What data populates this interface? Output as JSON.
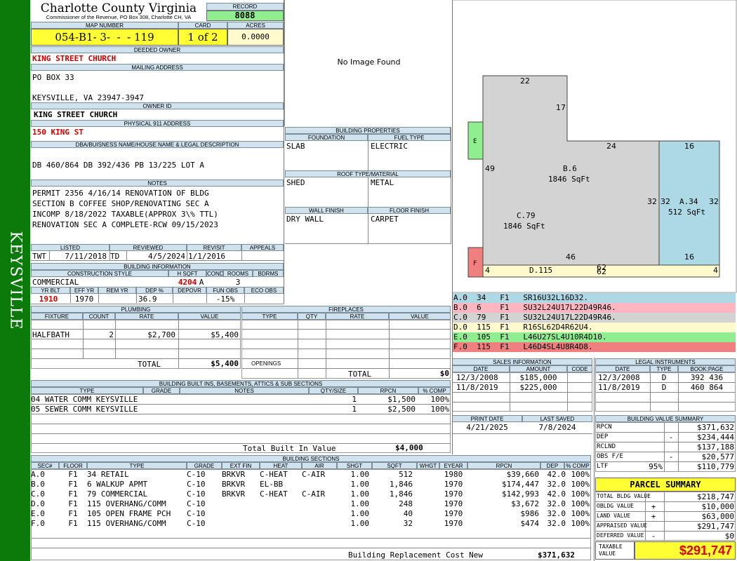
{
  "sidebar": {
    "label": "KEYSVILLE"
  },
  "county": {
    "title": "Charlotte County Virginia",
    "subtitle": "Commissioner of the Revenue, PO Box 308, Charlotte CH, VA"
  },
  "record": {
    "label": "RECORD",
    "value": "8088"
  },
  "map": {
    "label": "MAP NUMBER",
    "value": "054-B1- 3-  -  - 119"
  },
  "card": {
    "label": "CARD",
    "value": "1 of 2"
  },
  "acres": {
    "label": "ACRES",
    "value": "0.0000"
  },
  "owner": {
    "label": "DEEDED OWNER",
    "value": "KING STREET CHURCH"
  },
  "mailing": {
    "label": "MAILING ADDRESS",
    "line1": "PO BOX 33",
    "line2": "KEYSVILLE, VA 23947-3947"
  },
  "owner_id": {
    "label": "OWNER ID",
    "value": "KING STREET CHURCH"
  },
  "physical": {
    "label": "PHYSICAL 911 ADDRESS",
    "value": "150 KING ST"
  },
  "dba": {
    "label": "DBA/BUISNESS NAME/HOUSE NAME & LEGAL DESCRIPTION",
    "value": "DB 460/864 DB 392/436 PB 13/225 LOT A"
  },
  "notes": {
    "label": "NOTES",
    "lines": [
      "PERMIT 2356 4/16/14 RENOVATION OF BLDG",
      "SECTION B COFFEE SHOP/RENOVATING SEC A",
      "INCOMP 8/18/2022  TAXABLE(APPROX 3\\% TTL)",
      "RENOVATION SEC A COMPLETE-RCW 09/15/2023"
    ]
  },
  "listing": {
    "listed_label": "LISTED",
    "reviewed_label": "REVIEWED",
    "revisit_label": "REVISIT",
    "appeals_label": "APPEALS",
    "listed_by": "TWT",
    "listed_date": "7/11/2018",
    "reviewed_by": "TD",
    "reviewed_date": "4/5/2024",
    "revisit": "1/1/2016"
  },
  "bldg_info": {
    "label": "BUILDING INFORMATION",
    "h_cs": "CONSTRUCTION STYLE",
    "h_hsqft": "H SQFT",
    "h_cond": "COND",
    "h_rooms": "ROOMS",
    "h_bdrms": "BDRMS",
    "cs": "COMMERCIAL",
    "hsqft": "4204",
    "cond": "A",
    "rooms": "3",
    "h_yrblt": "YR BLT",
    "h_effyr": "EFF YR",
    "h_remyr": "REM YR",
    "h_dep": "DEP %",
    "h_depovr": "DEPOVR",
    "h_funobs": "FUN OBS",
    "h_ecoobs": "ECO OBS",
    "yrblt": "1910",
    "effyr": "1970",
    "dep": "36.9",
    "funobs": "-15%"
  },
  "plumbing": {
    "label": "PLUMBING",
    "headers": [
      "FIXTURE",
      "COUNT",
      "RATE",
      "VALUE"
    ],
    "rows": [
      {
        "fixture": "HALFBATH",
        "count": "2",
        "rate": "$2,700",
        "value": "$5,400"
      }
    ],
    "total_label": "TOTAL",
    "total": "$5,400"
  },
  "fireplaces": {
    "label": "FIREPLACES",
    "headers": [
      "TYPE",
      "QTY",
      "RATE",
      "VALUE"
    ],
    "openings": "OPENINGS",
    "total_label": "TOTAL",
    "total": "$0"
  },
  "builtins": {
    "label": "BUILDING BUILT INS, BASEMENTS, ATTICS & SUB SECTIONS",
    "headers": [
      "TYPE",
      "GRADE",
      "NOTES",
      "QTY/SIZE",
      "RPCN",
      "% COMP"
    ],
    "rows": [
      {
        "type": "04 WATER COMM KEYSVILLE",
        "qty": "1",
        "rpcn": "$1,500",
        "comp": "100%"
      },
      {
        "type": "05 SEWER COMM KEYSVILLE",
        "qty": "1",
        "rpcn": "$2,500",
        "comp": "100%"
      }
    ],
    "total_label": "Total Built In Value",
    "total": "$4,000"
  },
  "no_image": "No Image Found",
  "props": {
    "label": "BUILDING PROPERTIES",
    "foundation_label": "FOUNDATION",
    "fuel_label": "FUEL TYPE",
    "foundation": "SLAB",
    "fuel": "ELECTRIC",
    "roof_label": "ROOF TYPE/MATERIAL",
    "roof_type": "SHED",
    "roof_mat": "METAL",
    "wall_label": "WALL FINISH",
    "floor_label": "FLOOR FINISH",
    "wall": "DRY WALL",
    "floor": "CARPET"
  },
  "sketch": {
    "dims": {
      "d22": "22",
      "d17": "17",
      "d24": "24",
      "d16a": "16",
      "d49": "49",
      "d32a": "32",
      "d32b": "32",
      "d32c": "32",
      "d46": "46",
      "d16b": "16",
      "d62a": "62",
      "d62b": "62",
      "d4a": "4",
      "d4b": "4"
    },
    "labels": {
      "E": "E",
      "F": "F",
      "B": "B.6",
      "Bsq": "1846 SqFt",
      "C": "C.79",
      "Csq": "1846 SqFt",
      "A": "A.34",
      "Asq": "512 SqFt",
      "D": "D.115"
    },
    "colors": {
      "gray": "#d3d3d3",
      "blue": "#add8e6",
      "green": "#90ee90",
      "red": "#f08080",
      "yellow": "#fffacd",
      "pink": "#ffb6c1"
    }
  },
  "legend": [
    {
      "text": "A.0  34   F1   SR16U32L16D32.",
      "color": "#add8e6"
    },
    {
      "text": "B.0  6    F1   SU32L24U17L22D49R46.",
      "color": "#ffb6c1"
    },
    {
      "text": "C.0  79   F1   SU32L24U17L22D49R46.",
      "color": "#d3d3d3"
    },
    {
      "text": "D.0  115  F1   R16SL62D4R62U4.",
      "color": "#fffacd"
    },
    {
      "text": "E.0  105  F1   L46U27SL4U10R4D10.",
      "color": "#90ee90"
    },
    {
      "text": "F.0  115  F1   L46D4SL4U8R4D8.",
      "color": "#f08080"
    }
  ],
  "sales": {
    "label": "SALES INFORMATION",
    "headers": [
      "DATE",
      "AMOUNT",
      "CODE"
    ],
    "rows": [
      {
        "date": "12/3/2008",
        "amount": "$185,000"
      },
      {
        "date": "11/8/2019",
        "amount": "$225,000"
      }
    ]
  },
  "legal": {
    "label": "LEGAL INSTRUMENTS",
    "headers": [
      "DATE",
      "TYPE",
      "BOOK:PAGE"
    ],
    "rows": [
      {
        "date": "12/3/2008",
        "type": "D",
        "book": "392 436"
      },
      {
        "date": "11/8/2019",
        "type": "D",
        "book": "460 864"
      }
    ]
  },
  "print": {
    "print_label": "PRINT DATE",
    "saved_label": "LAST SAVED",
    "print_date": "4/21/2025",
    "saved_date": "7/8/2024"
  },
  "bvs": {
    "label": "BUILDING VALUE SUMMARY",
    "rows": [
      {
        "label": "RPCN",
        "sign": "",
        "value": "$371,632"
      },
      {
        "label": "DEP",
        "sign": "-",
        "value": "$234,444"
      },
      {
        "label": "RCLND",
        "sign": "",
        "value": "$137,188"
      },
      {
        "label": "OBS F/E",
        "sign": "-",
        "value": "$20,577"
      },
      {
        "label": "LTF",
        "pct": "95%",
        "sign": "",
        "value": "$110,779"
      }
    ]
  },
  "parcel": {
    "label": "PARCEL SUMMARY",
    "rows": [
      {
        "label": "TOTAL BLDG VALUE",
        "sign": "",
        "value": "$218,747"
      },
      {
        "label": "OBLDG VALUE",
        "sign": "+",
        "value": "$10,000"
      },
      {
        "label": "LAND VALUE",
        "sign": "+",
        "value": "$63,000"
      },
      {
        "label": "APPRAISED VALUE",
        "sign": "",
        "value": "$291,747"
      },
      {
        "label": "DEFERRED VALUE",
        "sign": "-",
        "value": "$0"
      }
    ],
    "taxable_label": "TAXABLE VALUE",
    "taxable": "$291,747"
  },
  "sections": {
    "label": "BUILDING SECTIONS",
    "headers": [
      "SEC#",
      "FLOOR",
      "TYPE",
      "GRADE",
      "EXT FIN",
      "HEAT",
      "AIR",
      "SHGT",
      "SQFT",
      "WHGT",
      "EYEAR",
      "RPCN",
      "DEP",
      "% COMP"
    ],
    "rows": [
      {
        "sec": "A.0",
        "floor": "F1",
        "type": "34 RETAIL",
        "grade": "C-10",
        "ext": "BRKVR",
        "heat": "C-HEAT",
        "air": "C-AIR",
        "shgt": "1.00",
        "sqft": "512",
        "eyear": "1980",
        "rpcn": "$39,660",
        "dep": "42.0",
        "comp": "100%"
      },
      {
        "sec": "B.0",
        "floor": "F1",
        "type": "6 WALKUP APMT",
        "grade": "C-10",
        "ext": "BRKVR",
        "heat": "EL-BB",
        "air": "",
        "shgt": "1.00",
        "sqft": "1,846",
        "eyear": "1970",
        "rpcn": "$174,447",
        "dep": "32.0",
        "comp": "100%"
      },
      {
        "sec": "C.0",
        "floor": "F1",
        "type": "79 COMMERCIAL",
        "grade": "C-10",
        "ext": "BRKVR",
        "heat": "C-HEAT",
        "air": "C-AIR",
        "shgt": "1.00",
        "sqft": "1,846",
        "eyear": "1970",
        "rpcn": "$142,993",
        "dep": "42.0",
        "comp": "100%"
      },
      {
        "sec": "D.0",
        "floor": "F1",
        "type": "115 OVERHANG/COMM",
        "grade": "C-10",
        "ext": "",
        "heat": "",
        "air": "",
        "shgt": "1.00",
        "sqft": "248",
        "eyear": "1970",
        "rpcn": "$3,672",
        "dep": "32.0",
        "comp": "100%"
      },
      {
        "sec": "E.0",
        "floor": "F1",
        "type": "105 OPEN FRAME PCH",
        "grade": "C-10",
        "ext": "",
        "heat": "",
        "air": "",
        "shgt": "1.00",
        "sqft": "40",
        "eyear": "1970",
        "rpcn": "$986",
        "dep": "32.0",
        "comp": "100%"
      },
      {
        "sec": "F.0",
        "floor": "F1",
        "type": "115 OVERHANG/COMM",
        "grade": "C-10",
        "ext": "",
        "heat": "",
        "air": "",
        "shgt": "1.00",
        "sqft": "32",
        "eyear": "1970",
        "rpcn": "$474",
        "dep": "32.0",
        "comp": "100%"
      }
    ],
    "total_label": "Building Replacement Cost New",
    "total": "$371,632"
  }
}
